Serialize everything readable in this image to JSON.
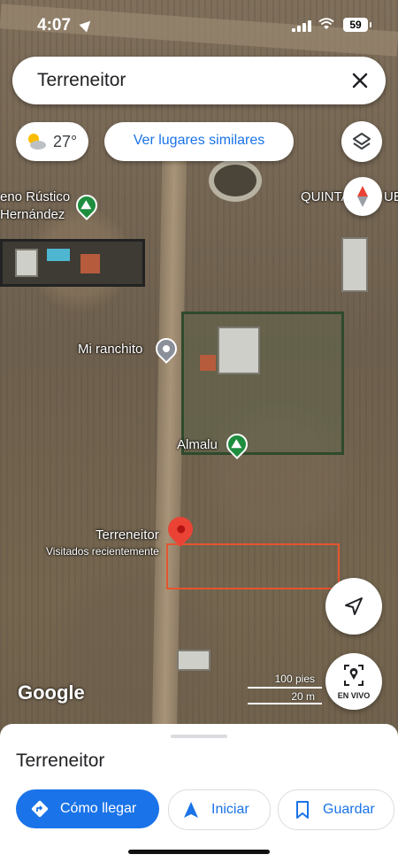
{
  "status_bar": {
    "time": "4:07",
    "battery": "59"
  },
  "search": {
    "query": "Terreneitor"
  },
  "chips": {
    "weather_temp": "27°",
    "similar_places": "Ver lugares similares"
  },
  "map_labels": {
    "rustic_1": "eno Rústico",
    "rustic_2": "Hernández",
    "quinta": "QUINTA",
    "quinta_suffix": "UE",
    "mi_ranchito": "Mi ranchito",
    "almalu": "Almalu",
    "terreneitor": "Terreneitor",
    "visited": "Visitados recientemente"
  },
  "map_overlay": {
    "google": "Google",
    "scale_ft": "100 pies",
    "scale_m": "20 m",
    "live_label": "EN VIVO"
  },
  "sheet": {
    "title": "Terreneitor",
    "directions_label": "Cómo llegar",
    "start_label": "Iniciar",
    "save_label": "Guardar"
  },
  "colors": {
    "accent": "#1a73e8",
    "pin_red": "#ea4335",
    "pin_green": "#1e8e3e",
    "parcel_outline": "#e4552f"
  }
}
